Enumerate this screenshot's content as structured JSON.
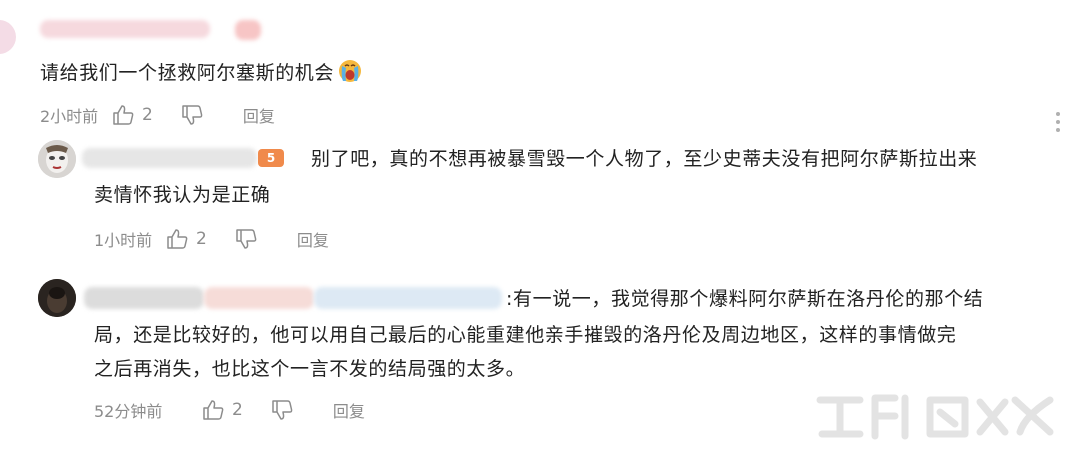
{
  "comments": [
    {
      "text": "请给我们一个拯救阿尔塞斯的机会",
      "time": "2小时前",
      "likes": "2",
      "reply_label": "回复",
      "emoji_icon": "crying-face-icon"
    },
    {
      "text_line1": "别了吧，真的不想再被暴雪毁一个人物了，至少史蒂夫没有把阿尔萨斯拉出来",
      "text_line2": "卖情怀我认为是正确",
      "time": "1小时前",
      "likes": "2",
      "reply_label": "回复",
      "level_badge": "5"
    },
    {
      "text_line1": ":有一说一，我觉得那个爆料阿尔萨斯在洛丹伦的那个结",
      "text_line2": "局，还是比较好的，他可以用自己最后的心能重建他亲手摧毁的洛丹伦及周边地区，这样的事情做完",
      "text_line3": "之后再消失，也比这个一言不发的结局强的太多。",
      "time": "52分钟前",
      "likes": "2",
      "reply_label": "回复"
    }
  ],
  "colors": {
    "text": "#222222",
    "meta": "#8c8c8c",
    "badge": "#f08a4b"
  }
}
